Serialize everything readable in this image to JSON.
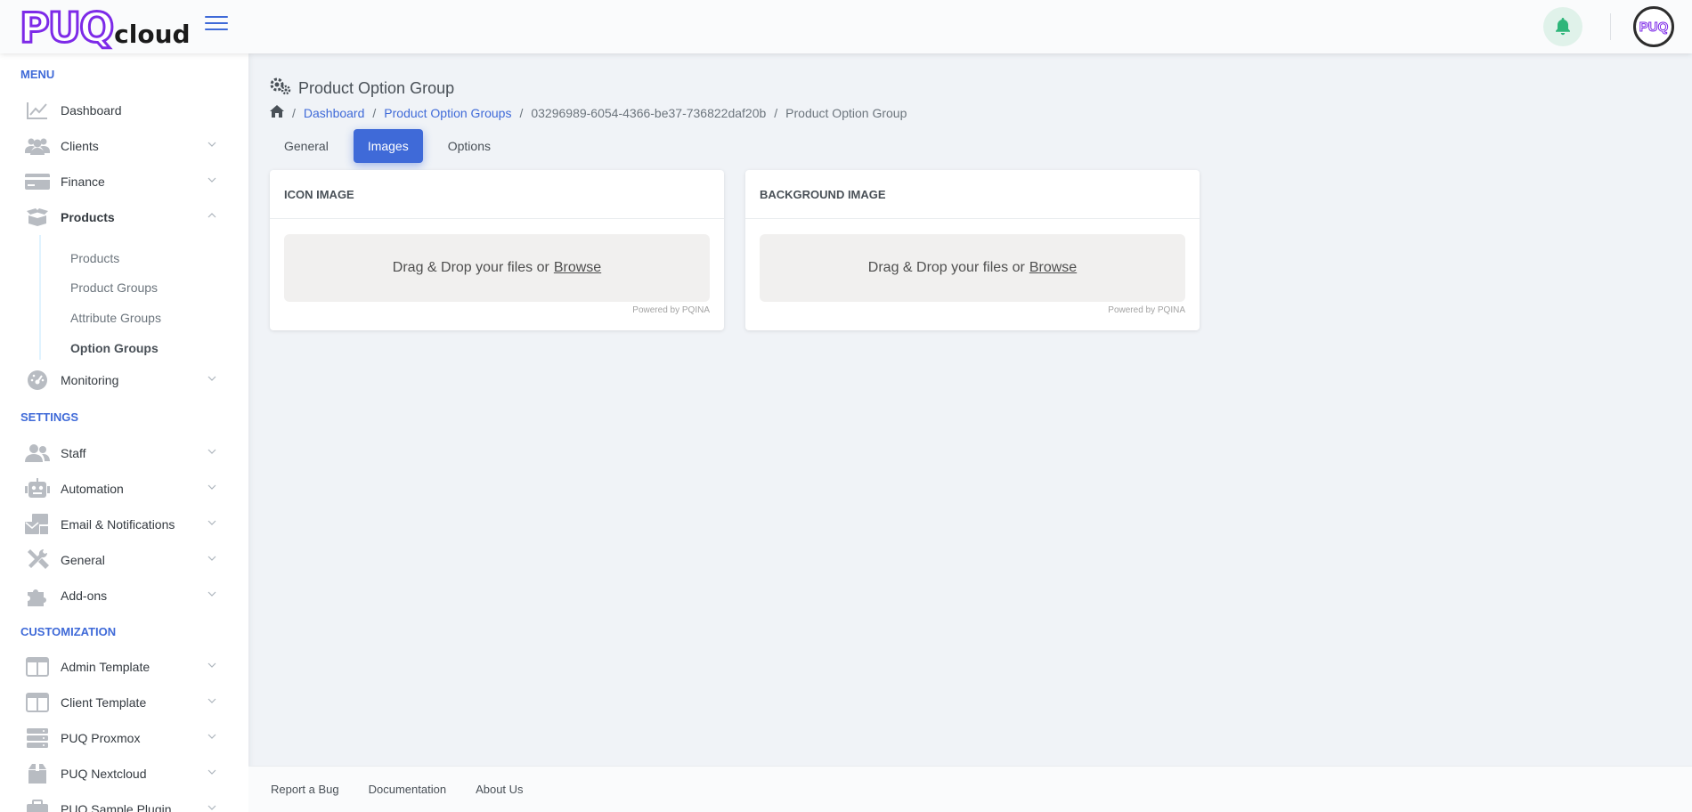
{
  "header": {
    "logo_main": "PUQ",
    "logo_sub": "cloud",
    "avatar_text": "PUQ"
  },
  "colors": {
    "accent": "#3f6ad8",
    "brand": "#7d2ae8",
    "notify": "#2fb67a"
  },
  "sidebar": {
    "sections": [
      "MENU",
      "SETTINGS",
      "CUSTOMIZATION"
    ],
    "menu": [
      {
        "label": "Dashboard",
        "icon": "chart-line-icon"
      },
      {
        "label": "Clients",
        "icon": "users-icon"
      },
      {
        "label": "Finance",
        "icon": "credit-card-icon"
      },
      {
        "label": "Products",
        "icon": "box-open-icon"
      },
      {
        "label": "Monitoring",
        "icon": "gauge-icon"
      }
    ],
    "products_sub": [
      "Products",
      "Product Groups",
      "Attribute Groups",
      "Option Groups"
    ],
    "settings": [
      {
        "label": "Staff",
        "icon": "user-group-icon"
      },
      {
        "label": "Automation",
        "icon": "robot-icon"
      },
      {
        "label": "Email & Notifications",
        "icon": "mail-bulk-icon"
      },
      {
        "label": "General",
        "icon": "tools-icon"
      },
      {
        "label": "Add-ons",
        "icon": "puzzle-icon"
      }
    ],
    "customization": [
      {
        "label": "Admin Template",
        "icon": "columns-icon"
      },
      {
        "label": "Client Template",
        "icon": "columns-icon"
      },
      {
        "label": "PUQ Proxmox",
        "icon": "server-icon"
      },
      {
        "label": "PUQ Nextcloud",
        "icon": "box-icon"
      },
      {
        "label": "PUQ Sample Plugin",
        "icon": "briefcase-icon"
      }
    ]
  },
  "page": {
    "title": "Product Option Group",
    "breadcrumb": [
      "Dashboard",
      "Product Option Groups",
      "03296989-6054-4366-be37-736822daf20b",
      "Product Option Group"
    ],
    "tabs": [
      "General",
      "Images",
      "Options"
    ],
    "active_tab": "Images"
  },
  "cards": [
    {
      "title": "ICON IMAGE",
      "drop_text": "Drag & Drop your files or",
      "browse": "Browse",
      "powered": "Powered by PQINA"
    },
    {
      "title": "BACKGROUND IMAGE",
      "drop_text": "Drag & Drop your files or",
      "browse": "Browse",
      "powered": "Powered by PQINA"
    }
  ],
  "footer": {
    "links": [
      "Report a Bug",
      "Documentation",
      "About Us"
    ]
  }
}
